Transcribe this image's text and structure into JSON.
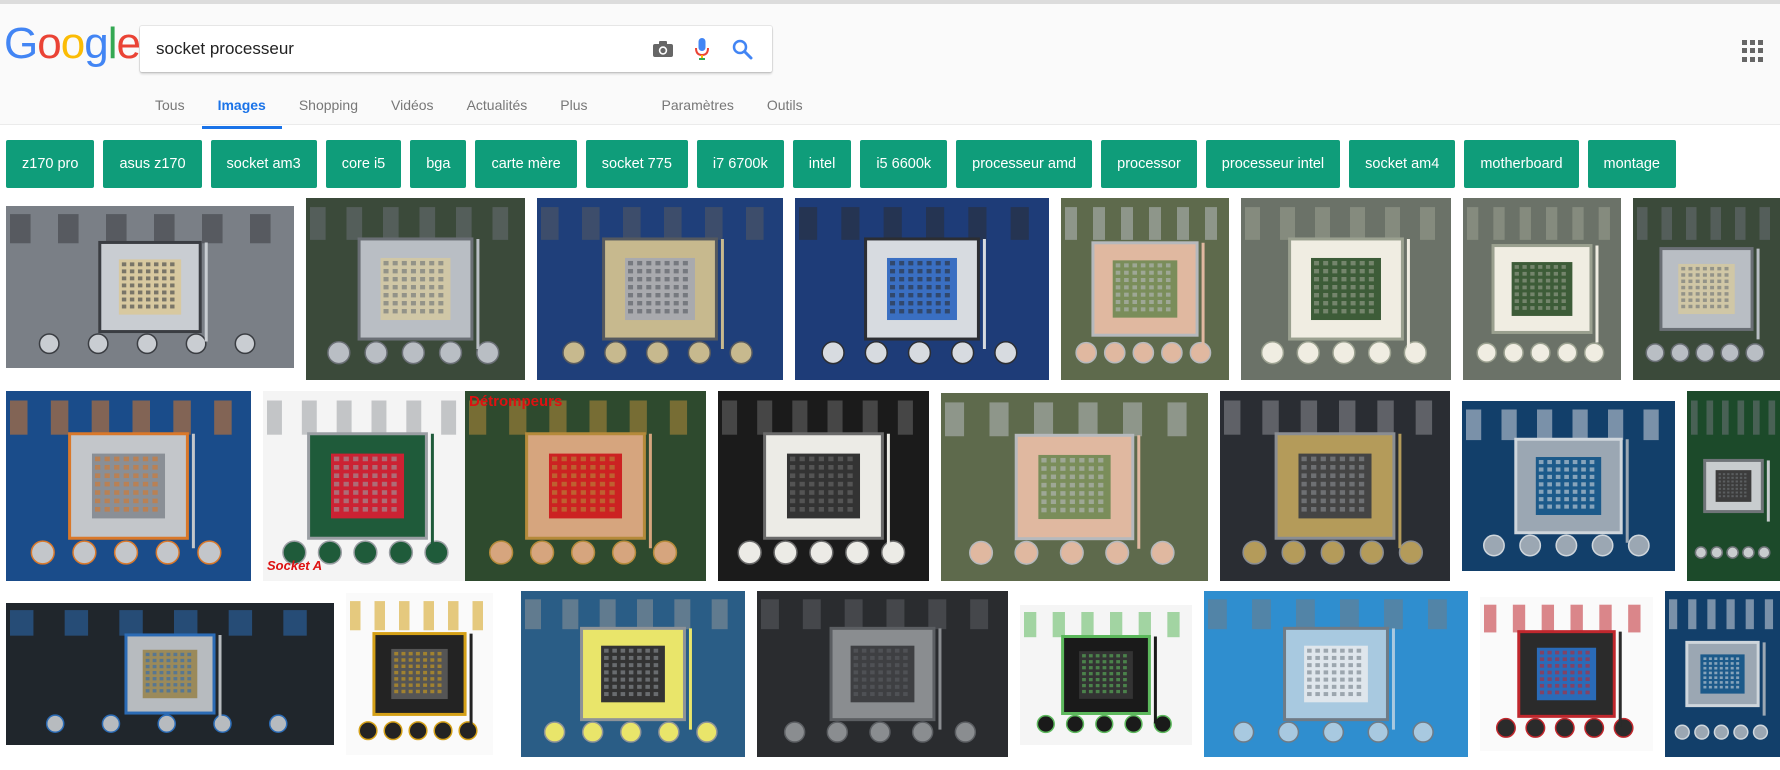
{
  "logo": {
    "letters": [
      "G",
      "o",
      "o",
      "g",
      "l",
      "e"
    ],
    "colors": [
      "#4285F4",
      "#EA4335",
      "#FBBC05",
      "#4285F4",
      "#34A853",
      "#EA4335"
    ]
  },
  "search": {
    "value": "socket processeur"
  },
  "icons": {
    "camera": "camera-icon",
    "mic": "microphone-icon",
    "search": "search-icon",
    "apps": "apps-grid-icon"
  },
  "tabs": [
    {
      "label": "Tous",
      "active": false
    },
    {
      "label": "Images",
      "active": true
    },
    {
      "label": "Shopping",
      "active": false
    },
    {
      "label": "Vidéos",
      "active": false
    },
    {
      "label": "Actualités",
      "active": false
    },
    {
      "label": "Plus",
      "active": false
    },
    {
      "label": "Paramètres",
      "active": false
    },
    {
      "label": "Outils",
      "active": false
    }
  ],
  "chips": [
    "z170 pro",
    "asus z170",
    "socket am3",
    "core i5",
    "bga",
    "carte mère",
    "socket 775",
    "i7 6700k",
    "intel",
    "i5 6600k",
    "processeur amd",
    "processor",
    "processeur intel",
    "socket am4",
    "motherboard",
    "montage"
  ],
  "accent": "#1a73e8",
  "chip_color": "#0f9d7a",
  "thumbnails": [
    {
      "row": 1,
      "style": "socket-metal",
      "caption": ""
    },
    {
      "row": 1,
      "style": "socket-board",
      "caption": ""
    },
    {
      "row": 1,
      "style": "socket-lga-blue",
      "caption": ""
    },
    {
      "row": 1,
      "style": "socket-intel-cpu",
      "caption": ""
    },
    {
      "row": 1,
      "style": "hand-cpu",
      "caption": ""
    },
    {
      "row": 1,
      "style": "socket-white",
      "caption": ""
    },
    {
      "row": 1,
      "style": "socket-white",
      "caption": ""
    },
    {
      "row": 1,
      "style": "socket-board",
      "caption": ""
    },
    {
      "row": 2,
      "style": "socket-blue-gigabyte",
      "caption": ""
    },
    {
      "row": 2,
      "style": "motherboard-full",
      "caption": "Socket A"
    },
    {
      "row": 2,
      "style": "hand-cpu-green",
      "caption": "Détrompeurs"
    },
    {
      "row": 2,
      "style": "socket-am3",
      "caption": ""
    },
    {
      "row": 2,
      "style": "hand-cpu",
      "caption": ""
    },
    {
      "row": 2,
      "style": "socket-lga-gold",
      "caption": ""
    },
    {
      "row": 2,
      "style": "socket-blue-board",
      "caption": ""
    },
    {
      "row": 2,
      "style": "cpu-chip",
      "caption": ""
    },
    {
      "row": 3,
      "style": "socket-intel-lid",
      "caption": ""
    },
    {
      "row": 3,
      "style": "motherboard-small",
      "caption": ""
    },
    {
      "row": 3,
      "style": "socket-yellow-label",
      "caption": ""
    },
    {
      "row": 3,
      "style": "socket-dark",
      "caption": ""
    },
    {
      "row": 3,
      "style": "motherboard-box",
      "caption": ""
    },
    {
      "row": 3,
      "style": "socket-blue-heatsink",
      "caption": ""
    },
    {
      "row": 3,
      "style": "motherboard-red",
      "caption": ""
    },
    {
      "row": 3,
      "style": "socket-blue-board",
      "caption": ""
    }
  ]
}
